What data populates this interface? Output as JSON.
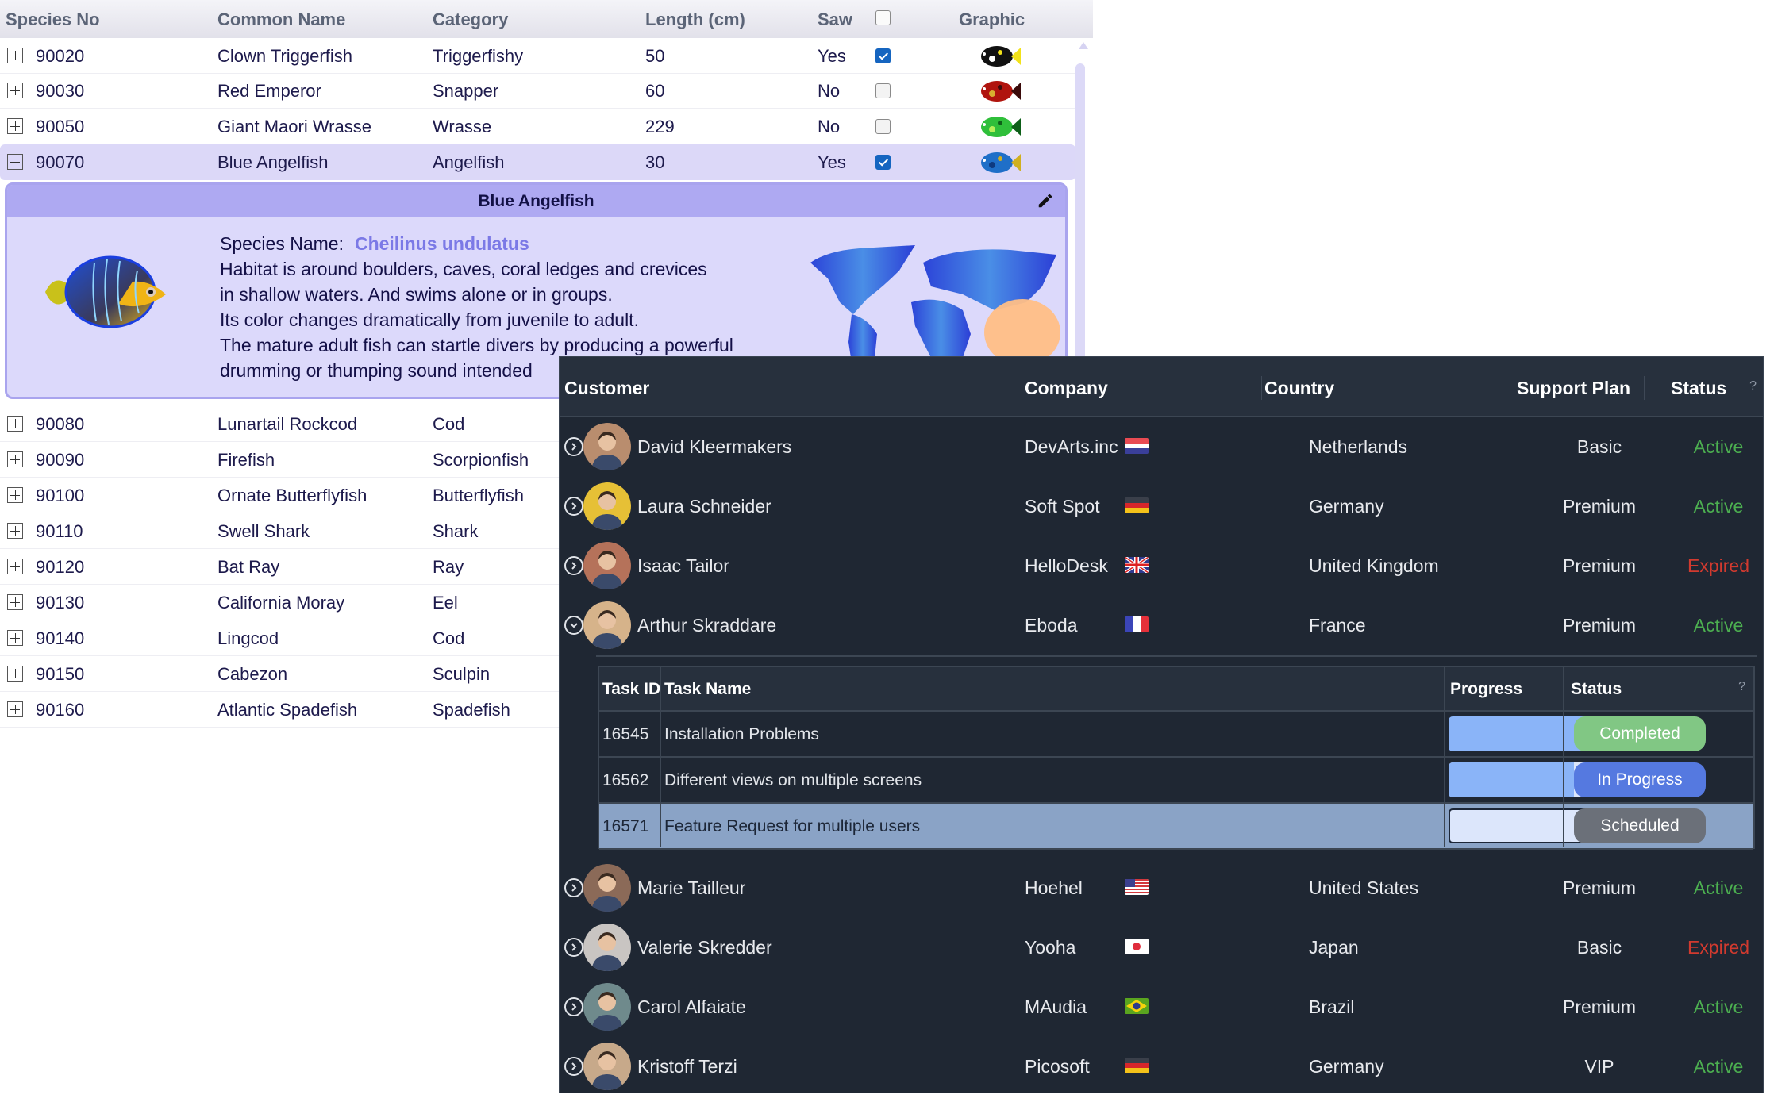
{
  "fish_grid": {
    "columns": [
      "Species No",
      "Common Name",
      "Category",
      "Length (cm)",
      "Saw",
      "Graphic"
    ],
    "header_checkbox_checked": false,
    "rows_top": [
      {
        "species_no": "90020",
        "common_name": "Clown Triggerfish",
        "category": "Triggerfishy",
        "length": "50",
        "saw": "Yes",
        "checked": true,
        "expanded": false,
        "graphic": "clown-triggerfish-image"
      },
      {
        "species_no": "90030",
        "common_name": "Red Emperor",
        "category": "Snapper",
        "length": "60",
        "saw": "No",
        "checked": false,
        "expanded": false,
        "graphic": "red-emperor-image"
      },
      {
        "species_no": "90050",
        "common_name": "Giant Maori Wrasse",
        "category": "Wrasse",
        "length": "229",
        "saw": "No",
        "checked": false,
        "expanded": false,
        "graphic": "giant-maori-wrasse-image"
      },
      {
        "species_no": "90070",
        "common_name": "Blue Angelfish",
        "category": "Angelfish",
        "length": "30",
        "saw": "Yes",
        "checked": true,
        "expanded": true,
        "graphic": "blue-angelfish-image"
      }
    ],
    "detail": {
      "title": "Blue Angelfish",
      "species_label": "Species Name:",
      "species_value": "Cheilinus undulatus",
      "description_lines": [
        "Habitat is around boulders, caves, coral ledges and crevices",
        "in shallow waters. And swims alone or in groups.",
        "Its color changes dramatically from juvenile to adult.",
        "The mature adult fish can startle divers by producing a powerful",
        "drumming or thumping sound intended"
      ],
      "edit_icon": "pencil-icon",
      "map": "world-map-habitat"
    },
    "rows_bottom": [
      {
        "species_no": "90080",
        "common_name": "Lunartail Rockcod",
        "category": "Cod"
      },
      {
        "species_no": "90090",
        "common_name": "Firefish",
        "category": "Scorpionfish"
      },
      {
        "species_no": "90100",
        "common_name": "Ornate Butterflyfish",
        "category": "Butterflyfish"
      },
      {
        "species_no": "90110",
        "common_name": "Swell Shark",
        "category": "Shark"
      },
      {
        "species_no": "90120",
        "common_name": "Bat Ray",
        "category": "Ray"
      },
      {
        "species_no": "90130",
        "common_name": "California Moray",
        "category": "Eel"
      },
      {
        "species_no": "90140",
        "common_name": "Lingcod",
        "category": "Cod"
      },
      {
        "species_no": "90150",
        "common_name": "Cabezon",
        "category": "Sculpin"
      },
      {
        "species_no": "90160",
        "common_name": "Atlantic Spadefish",
        "category": "Spadefish"
      }
    ]
  },
  "customer_grid": {
    "columns": [
      "Customer",
      "Company",
      "Country",
      "Support Plan",
      "Status"
    ],
    "help": "?",
    "colors": {
      "active": "#4caf50",
      "expired": "#d13a2f"
    },
    "rows_top": [
      {
        "name": "David Kleermakers",
        "company": "DevArts.inc",
        "country": "Netherlands",
        "flag": "nl",
        "plan": "Basic",
        "status": "Active",
        "expanded": false
      },
      {
        "name": "Laura Schneider",
        "company": "Soft Spot",
        "country": "Germany",
        "flag": "de",
        "plan": "Premium",
        "status": "Active",
        "expanded": false
      },
      {
        "name": "Isaac Tailor",
        "company": "HelloDesk",
        "country": "United Kingdom",
        "flag": "gb",
        "plan": "Premium",
        "status": "Expired",
        "expanded": false
      },
      {
        "name": "Arthur Skraddare",
        "company": "Eboda",
        "country": "France",
        "flag": "fr",
        "plan": "Premium",
        "status": "Active",
        "expanded": true
      }
    ],
    "tasks": {
      "columns": [
        "Task ID",
        "Task Name",
        "Progress",
        "Status"
      ],
      "help": "?",
      "rows": [
        {
          "id": "16545",
          "name": "Installation Problems",
          "progress": 100,
          "status": "Completed",
          "selected": false
        },
        {
          "id": "16562",
          "name": "Different views on multiple screens",
          "progress": 80,
          "status": "In Progress",
          "selected": false
        },
        {
          "id": "16571",
          "name": "Feature Request for multiple users",
          "progress": 0,
          "status": "Scheduled",
          "selected": true
        }
      ]
    },
    "rows_bottom": [
      {
        "name": "Marie Tailleur",
        "company": "Hoehel",
        "country": "United States",
        "flag": "us",
        "plan": "Premium",
        "status": "Active"
      },
      {
        "name": "Valerie Skredder",
        "company": "Yooha",
        "country": "Japan",
        "flag": "jp",
        "plan": "Basic",
        "status": "Expired"
      },
      {
        "name": "Carol Alfaiate",
        "company": "MAudia",
        "country": "Brazil",
        "flag": "br",
        "plan": "Premium",
        "status": "Active"
      },
      {
        "name": "Kristoff Terzi",
        "company": "Picosoft",
        "country": "Germany",
        "flag": "de",
        "plan": "VIP",
        "status": "Active"
      }
    ]
  }
}
